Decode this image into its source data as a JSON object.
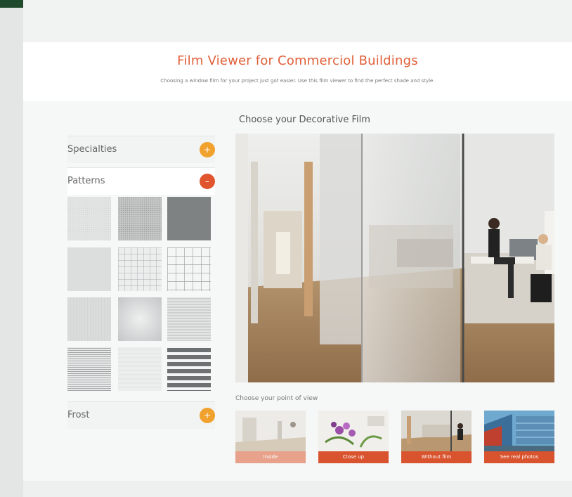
{
  "header": {
    "title": "Film Viewer for Commerciol Buildings",
    "subtitle": "Choosing a window film for your project just got easier. Use this film viewer to find the perfect shade and style."
  },
  "sidebar": {
    "sections": [
      {
        "label": "Specialties",
        "toggle": "+",
        "color": "#f0a12e"
      },
      {
        "label": "Patterns",
        "toggle": "–",
        "color": "#e0552e"
      },
      {
        "label": "Frost",
        "toggle": "+",
        "color": "#f0a12e"
      }
    ]
  },
  "main": {
    "heading": "Choose your Decorative Film",
    "pov_heading": "Choose your point of view",
    "pov_options": [
      {
        "label": "Inside",
        "selected": true
      },
      {
        "label": "Close up",
        "selected": false
      },
      {
        "label": "Without film",
        "selected": false
      },
      {
        "label": "See real photos",
        "selected": false
      }
    ]
  },
  "colors": {
    "accent": "#e0603a",
    "orange_toggle": "#f0a12e",
    "red_toggle": "#e0552e",
    "pov_selected": "#e8a18a",
    "pov_default": "#d9532e"
  },
  "icons": {
    "specialties_toggle": "plus-icon",
    "patterns_toggle": "minus-icon",
    "frost_toggle": "plus-icon"
  }
}
